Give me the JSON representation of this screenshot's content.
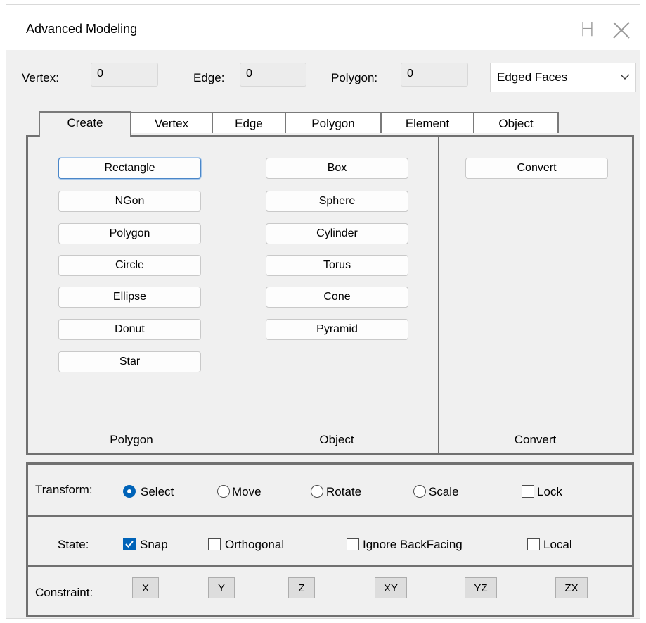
{
  "window": {
    "title": "Advanced Modeling",
    "help_glyph": "H"
  },
  "counts": {
    "vertex_label": "Vertex:",
    "vertex_value": "0",
    "edge_label": "Edge:",
    "edge_value": "0",
    "polygon_label": "Polygon:",
    "polygon_value": "0",
    "display_mode": "Edged Faces"
  },
  "tabs": [
    "Create",
    "Vertex",
    "Edge",
    "Polygon",
    "Element",
    "Object"
  ],
  "create_panel": {
    "polygon_buttons": [
      "Rectangle",
      "NGon",
      "Polygon",
      "Circle",
      "Ellipse",
      "Donut",
      "Star"
    ],
    "object_buttons": [
      "Box",
      "Sphere",
      "Cylinder",
      "Torus",
      "Cone",
      "Pyramid"
    ],
    "convert_buttons": [
      "Convert"
    ],
    "footers": [
      "Polygon",
      "Object",
      "Convert"
    ]
  },
  "transform": {
    "label": "Transform:",
    "options": [
      "Select",
      "Move",
      "Rotate",
      "Scale"
    ],
    "selected": "Select",
    "lock_label": "Lock"
  },
  "state": {
    "label": "State:",
    "options": [
      {
        "label": "Snap",
        "checked": true
      },
      {
        "label": "Orthogonal",
        "checked": false
      },
      {
        "label": "Ignore BackFacing",
        "checked": false
      },
      {
        "label": "Local",
        "checked": false
      }
    ]
  },
  "constraint": {
    "label": "Constraint:",
    "buttons": [
      "X",
      "Y",
      "Z",
      "XY",
      "YZ",
      "ZX"
    ]
  },
  "colors": {
    "accent": "#0063b8",
    "panel_border": "#707070",
    "background": "#f0f0f0"
  }
}
